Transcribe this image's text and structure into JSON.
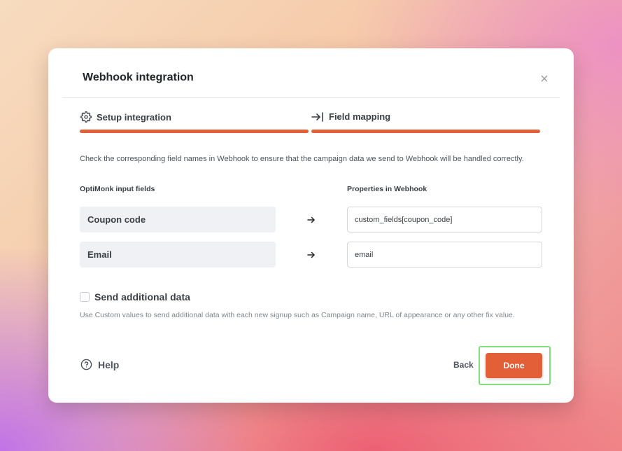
{
  "modal": {
    "title": "Webhook integration",
    "close_icon": "close-icon"
  },
  "steps": [
    {
      "label": "Setup integration",
      "icon": "gear-icon",
      "state": "completed"
    },
    {
      "label": "Field mapping",
      "icon": "arrow-to-bar-icon",
      "state": "active"
    }
  ],
  "accent_color": "#e35f37",
  "description": "Check the corresponding field names in Webhook to ensure that the campaign data we send to Webhook will be handled correctly.",
  "mapping": {
    "left_header": "OptiMonk input fields",
    "right_header": "Properties in Webhook",
    "rows": [
      {
        "input": "Coupon code",
        "property": "custom_fields[coupon_code]"
      },
      {
        "input": "Email",
        "property": "email"
      }
    ]
  },
  "additional": {
    "checkbox_label": "Send additional data",
    "checked": false,
    "help_text": "Use Custom values to send additional data with each new signup such as Campaign name, URL of appearance or any other fix value."
  },
  "footer": {
    "help_label": "Help",
    "back_label": "Back",
    "done_label": "Done"
  }
}
